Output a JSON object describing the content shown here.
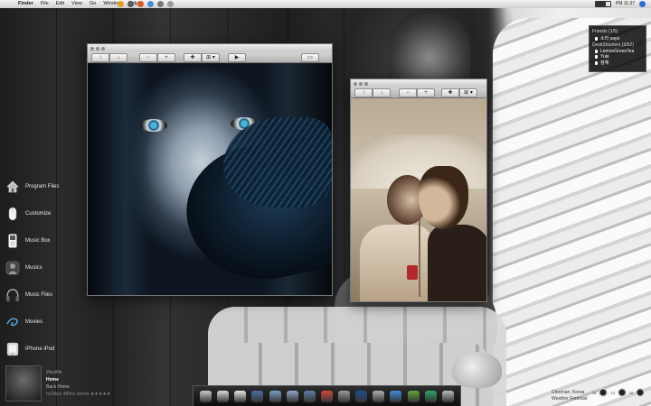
{
  "menubar": {
    "apple": "",
    "items": [
      "Finder",
      "File",
      "Edit",
      "View",
      "Go",
      "Window",
      "Help"
    ],
    "clock": "PM 11:37"
  },
  "window1": {
    "toolbar": [
      "↑",
      "↓",
      "−",
      "+",
      "✚",
      "⊞ ▾",
      "▶",
      "▭"
    ]
  },
  "window2": {
    "toolbar": [
      "↑",
      "↓",
      "−",
      "+",
      "✚",
      "⊞ ▾",
      "▭"
    ]
  },
  "sidebar": {
    "items": [
      {
        "label": "Program Files",
        "icon": "house-icon"
      },
      {
        "label": "Customize",
        "icon": "mouse-icon"
      },
      {
        "label": "Music Box",
        "icon": "ipod-icon"
      },
      {
        "label": "Musics",
        "icon": "musics-icon"
      },
      {
        "label": "Music Files",
        "icon": "headphones-icon"
      },
      {
        "label": "Movies",
        "icon": "swirl-icon"
      },
      {
        "label": "iPhone iPod",
        "icon": "iphone-icon"
      }
    ]
  },
  "buddy_widget": {
    "groups": [
      {
        "name": "Friends (1/5)",
        "buddies": [
          "소라 saya"
        ]
      },
      {
        "name": "DeskShooters (3/62)",
        "buddies": [
          "LemonGreenTea",
          "Yuki",
          "정혜"
        ]
      }
    ]
  },
  "itunes": {
    "artist": "Westlife",
    "track": "Home",
    "album": "Back Home",
    "meta": "m28kpx 48khz stereo  ★★★★★"
  },
  "weather": {
    "location": "Cheonan, Korea",
    "provider": "Weather Forecast",
    "days": [
      "16",
      "13",
      "16"
    ]
  },
  "dock": {
    "icons": [
      "trash-icon",
      "finder-icon",
      "itunes-icon",
      "photos-icon",
      "quicktime-icon",
      "safari-icon",
      "mail-icon",
      "ical-icon",
      "calculator-icon",
      "photoshop-icon",
      "system-preferences-icon",
      "itunes-blue-icon",
      "adium-icon",
      "coda-icon",
      "downloads-icon"
    ],
    "colors": [
      "#cccccc",
      "#dddddd",
      "#e9e9e9",
      "#4a6ea3",
      "#7e9fc4",
      "#8fa8c6",
      "#5d7fa8",
      "#d24a3c",
      "#9a9a9a",
      "#1e4f8a",
      "#b0b0b0",
      "#3d8fd8",
      "#5fa63a",
      "#2fa36a",
      "#bbbbbb"
    ]
  }
}
